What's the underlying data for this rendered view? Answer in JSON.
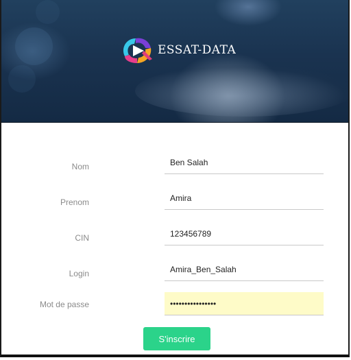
{
  "brand": {
    "name": "ESSAT-DATA",
    "logo": "essat-data-logo"
  },
  "form": {
    "fields": [
      {
        "label": "Nom",
        "value": "Ben Salah",
        "type": "text"
      },
      {
        "label": "Prenom",
        "value": "Amira",
        "type": "text"
      },
      {
        "label": "CIN",
        "value": "123456789",
        "type": "text"
      },
      {
        "label": "Login",
        "value": "Amira_Ben_Salah",
        "type": "text"
      },
      {
        "label": "Mot de passe",
        "value": "••••••••••••••••",
        "type": "password"
      }
    ],
    "submit_label": "S'inscrire"
  },
  "colors": {
    "primary": "#2bd38a",
    "hero_dark": "#1a3350",
    "autofill": "#fefbc8"
  }
}
